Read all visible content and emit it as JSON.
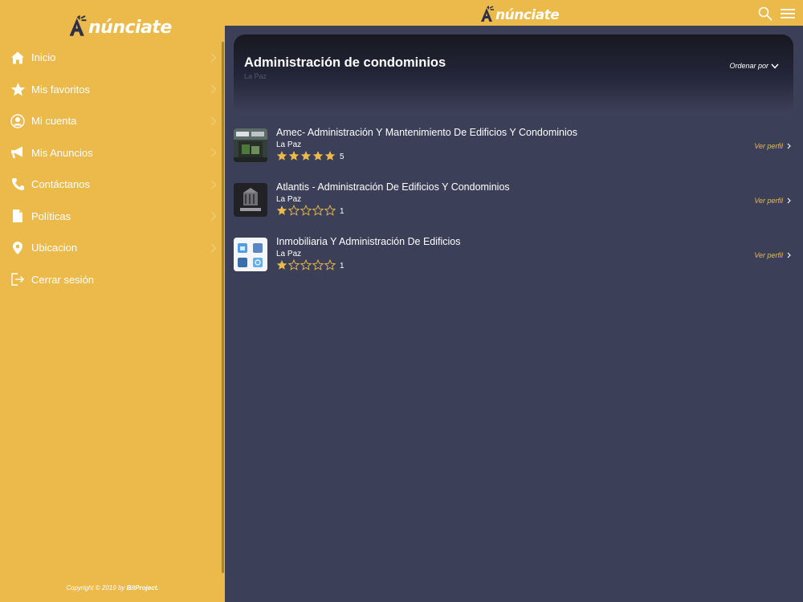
{
  "app": {
    "logo_text": "núnciate",
    "logo_a": "A"
  },
  "colors": {
    "accent": "#ebba4b",
    "background": "#3c3f58",
    "text": "#ffffff"
  },
  "sidebar": {
    "items": [
      {
        "label": "Inicio",
        "icon": "home-icon"
      },
      {
        "label": "Mis favoritos",
        "icon": "star-icon"
      },
      {
        "label": "Mi cuenta",
        "icon": "user-icon"
      },
      {
        "label": "Mis Anuncios",
        "icon": "megaphone-icon"
      },
      {
        "label": "Contáctanos",
        "icon": "phone-icon"
      },
      {
        "label": "Políticas",
        "icon": "document-icon"
      },
      {
        "label": "Ubicacion",
        "icon": "location-pin-icon"
      },
      {
        "label": "Cerrar sesión",
        "icon": "logout-icon"
      }
    ],
    "copyright": "Copyright © 2019 by",
    "copyright_brand": "BitProject."
  },
  "header": {
    "title": "Administración de condominios",
    "subtitle": "La Paz",
    "sort_label": "Ordenar por"
  },
  "listings": [
    {
      "title": "Amec- Administración Y Mantenimiento De Edificios Y Condominios",
      "city": "La Paz",
      "stars": 5,
      "rating": "5",
      "link": "Ver perfil"
    },
    {
      "title": "Atlantis - Administración De Edificios Y Condominios",
      "city": "La Paz",
      "stars": 1,
      "rating": "1",
      "link": "Ver perfil"
    },
    {
      "title": "Inmobiliaria Y Administración De Edificios",
      "city": "La Paz",
      "stars": 1,
      "rating": "1",
      "link": "Ver perfil"
    }
  ]
}
